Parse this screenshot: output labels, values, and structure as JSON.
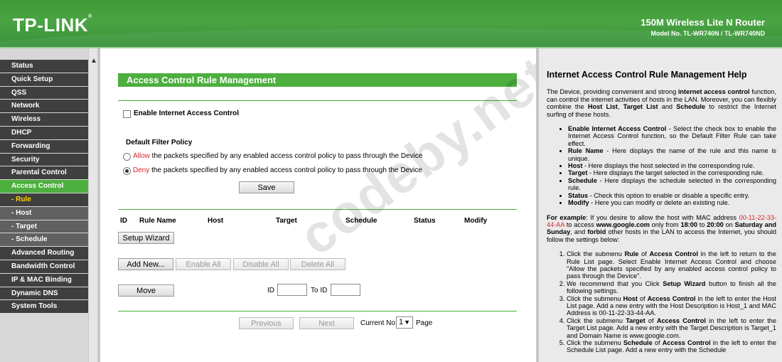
{
  "header": {
    "logo": "TP-LINK",
    "product_title": "150M Wireless Lite N Router",
    "model": "Model No. TL-WR740N / TL-WR740ND"
  },
  "nav": {
    "items": [
      {
        "label": "Status",
        "active": false,
        "sub": false
      },
      {
        "label": "Quick Setup",
        "active": false,
        "sub": false
      },
      {
        "label": "QSS",
        "active": false,
        "sub": false
      },
      {
        "label": "Network",
        "active": false,
        "sub": false
      },
      {
        "label": "Wireless",
        "active": false,
        "sub": false
      },
      {
        "label": "DHCP",
        "active": false,
        "sub": false
      },
      {
        "label": "Forwarding",
        "active": false,
        "sub": false
      },
      {
        "label": "Security",
        "active": false,
        "sub": false
      },
      {
        "label": "Parental Control",
        "active": false,
        "sub": false
      },
      {
        "label": "Access Control",
        "active": true,
        "sub": false
      },
      {
        "label": "- Rule",
        "active": true,
        "sub": true
      },
      {
        "label": "- Host",
        "active": false,
        "sub": true
      },
      {
        "label": "- Target",
        "active": false,
        "sub": true
      },
      {
        "label": "- Schedule",
        "active": false,
        "sub": true
      },
      {
        "label": "Advanced Routing",
        "active": false,
        "sub": false
      },
      {
        "label": "Bandwidth Control",
        "active": false,
        "sub": false
      },
      {
        "label": "IP & MAC Binding",
        "active": false,
        "sub": false
      },
      {
        "label": "Dynamic DNS",
        "active": false,
        "sub": false
      },
      {
        "label": "System Tools",
        "active": false,
        "sub": false
      }
    ]
  },
  "main": {
    "title": "Access Control Rule Management",
    "enable_label": "Enable Internet Access Control",
    "enable_checked": false,
    "policy_heading": "Default Filter Policy",
    "allow_word": "Allow",
    "allow_rest": " the packets specified by any enabled access control policy to pass through the Device",
    "deny_word": "Deny",
    "deny_rest": " the packets specified by any enabled access control policy to pass through the Device",
    "selected_policy": "deny",
    "save_label": "Save",
    "columns": [
      "ID",
      "Rule Name",
      "Host",
      "Target",
      "Schedule",
      "Status",
      "Modify"
    ],
    "setup_wizard_label": "Setup Wizard",
    "add_new_label": "Add New...",
    "enable_all_label": "Enable All",
    "disable_all_label": "Disable All",
    "delete_all_label": "Delete All",
    "move_label": "Move",
    "id_label": "ID",
    "to_id_label": "To ID",
    "previous_label": "Previous",
    "next_label": "Next",
    "current_no_label": "Current No.",
    "current_no_value": "1",
    "page_label": "Page"
  },
  "watermark": "codeby.net",
  "help": {
    "title": "Internet Access Control Rule Management Help",
    "intro_html": "The Device, providing convenient and strong <b>internet access control</b> function, can control the internet activities of hosts in the LAN. Moreover, you can flexibly combine the <b>Host List</b>, <b>Target List</b> and <b>Schedule</b> to restrict the Internet surfing of these hosts.",
    "bullets_html": [
      "<b>Enable Internet Access Control</b> - Select the check box to enable the Internet Access Control function, so the Default Filter Rule can take effect.",
      "<b>Rule Name</b> - Here displays the name of the rule and this name is unique.",
      "<b>Host</b> - Here displays the host selected in the corresponding rule.",
      "<b>Target</b> - Here displays the target selected in the corresponding rule.",
      "<b>Schedule</b> - Here displays the schedule selected in the corresponding rule.",
      "<b>Status</b> - Check this option to enable or disable a specific entry.",
      "<b>Modify</b> - Here you can modify or delete an existing rule."
    ],
    "example_html": "<b>For example</b>: If you desire to allow the host with MAC address <span class=\"macred\">00-11-22-33-44-AA</span> to access <b>www.google.com</b> only from <b>18:00</b> to <b>20:00</b> on <b>Saturday and Sunday</b>, and <b>forbid</b> other hosts in the LAN to access the Internet, you should follow the settings below:",
    "steps_html": [
      "Click the submenu <b>Rule</b> of <b>Access Control</b> in the left to return to the Rule List page. Select Enable Internet Access Control and choose \"Allow the packets specified by any enabled access control policy to pass through the Device\".",
      "We recommend that you Click <b>Setup Wizard</b> button to finish all the following settings.",
      "Click the submenu <b>Host</b> of <b>Access Control</b> in the left to enter the Host List page. Add a new entry with the Host Description is Host_1 and MAC Address is 00-11-22-33-44-AA.",
      "Click the submenu <b>Target</b> of <b>Access Control</b> in the left to enter the Target List page. Add a new entry with the Target Description is Target_1 and Domain Name is www.google.com.",
      "Click the submenu <b>Schedule</b> of <b>Access Control</b> in the left to enter the Schedule List page. Add a new entry with the Schedule"
    ]
  }
}
